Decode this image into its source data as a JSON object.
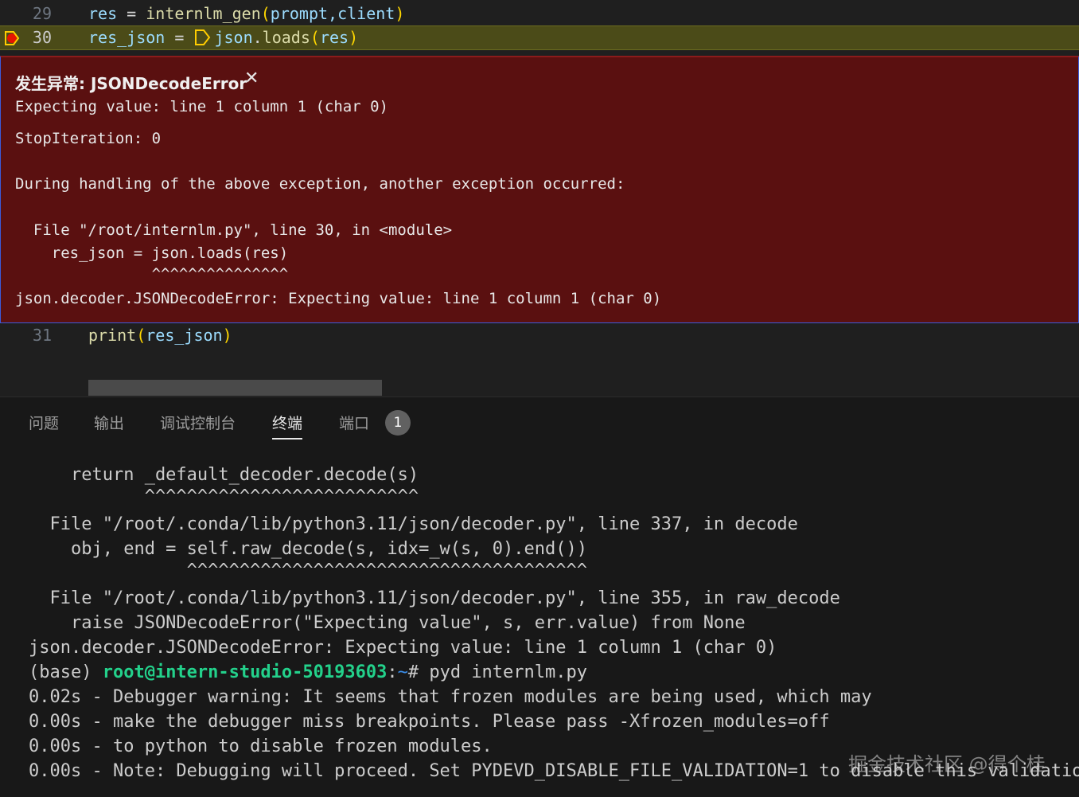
{
  "editor": {
    "line29": {
      "number": "29",
      "var": "res",
      "eq": " = ",
      "fn": "internlm_gen",
      "open": "(",
      "args": "prompt,client",
      "close": ")"
    },
    "line30": {
      "number": "30",
      "var": "res_json",
      "eq": " = ",
      "mod": "json",
      "dot": ".",
      "fn": "loads",
      "open": "(",
      "args": "res",
      "close": ")"
    },
    "line31": {
      "number": "31",
      "fn": "print",
      "open": "(",
      "args": "res_json",
      "close": ")"
    }
  },
  "exception": {
    "title": "发生异常: JSONDecodeError",
    "lines": [
      "Expecting value: line 1 column 1 (char 0)",
      "StopIteration: 0",
      "During handling of the above exception, another exception occurred:",
      "  File \"/root/internlm.py\", line 30, in <module>",
      "    res_json = json.loads(res)",
      "               ^^^^^^^^^^^^^^^",
      "json.decoder.JSONDecodeError: Expecting value: line 1 column 1 (char 0)"
    ]
  },
  "panel": {
    "tabs": [
      "问题",
      "输出",
      "调试控制台",
      "终端",
      "端口"
    ],
    "active_tab": "终端",
    "ports_badge": "1"
  },
  "terminal": {
    "lines": [
      "    return _default_decoder.decode(s)",
      "           ^^^^^^^^^^^^^^^^^^^^^^^^^^",
      "  File \"/root/.conda/lib/python3.11/json/decoder.py\", line 337, in decode",
      "    obj, end = self.raw_decode(s, idx=_w(s, 0).end())",
      "               ^^^^^^^^^^^^^^^^^^^^^^^^^^^^^^^^^^^^^^",
      "  File \"/root/.conda/lib/python3.11/json/decoder.py\", line 355, in raw_decode",
      "    raise JSONDecodeError(\"Expecting value\", s, err.value) from None",
      "json.decoder.JSONDecodeError: Expecting value: line 1 column 1 (char 0)"
    ],
    "prompt_prefix": "(base) ",
    "prompt_user": "root@intern-studio-50193603",
    "prompt_sep": ":",
    "prompt_path": "~",
    "prompt_cmd": "# pyd internlm.py",
    "debug_lines": [
      "0.02s - Debugger warning: It seems that frozen modules are being used, which may",
      "0.00s - make the debugger miss breakpoints. Please pass -Xfrozen_modules=off",
      "0.00s - to python to disable frozen modules.",
      "0.00s - Note: Debugging will proceed. Set PYDEVD_DISABLE_FILE_VALIDATION=1 to disable this validation"
    ]
  },
  "watermark": "掘金技术社区 @得个桂",
  "colors": {
    "exception_bg": "#5a1010",
    "current_line": "#4b4b18",
    "prompt_user": "#23d18b"
  }
}
